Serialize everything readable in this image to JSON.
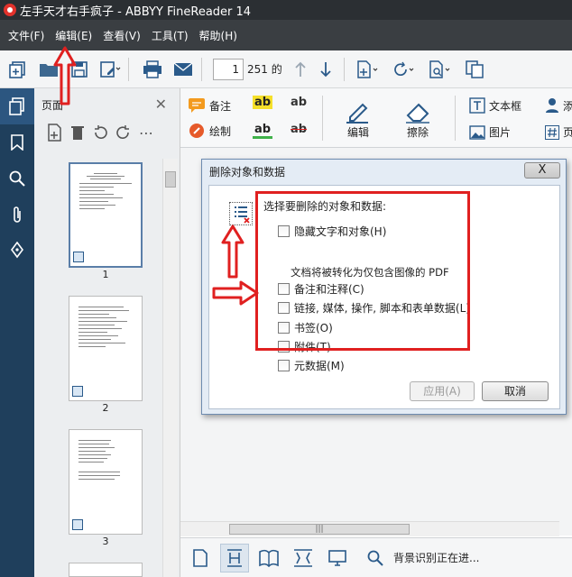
{
  "window": {
    "title": "左手天才右手疯子 - ABBYY FineReader 14"
  },
  "menu": [
    "文件(F)",
    "编辑(E)",
    "查看(V)",
    "工具(T)",
    "帮助(H)"
  ],
  "toolbar": {
    "current_page": "1",
    "page_total": "251 的"
  },
  "pages_panel": {
    "title": "页面",
    "thumbnails": [
      {
        "number": "1"
      },
      {
        "number": "2"
      },
      {
        "number": "3"
      }
    ]
  },
  "ribbon": {
    "note": "备注",
    "draw": "绘制",
    "edit": "编辑",
    "erase": "擦除",
    "textbox": "文本框",
    "add": "添",
    "image": "图片",
    "page_partial": "页",
    "ab": "ab"
  },
  "dialog": {
    "title": "删除对象和数据",
    "close": "X",
    "heading": "选择要删除的对象和数据:",
    "options": [
      {
        "label": "隐藏文字和对象(H)",
        "checked": false
      },
      {
        "label": "备注和注释(C)",
        "checked": false
      },
      {
        "label": "链接, 媒体, 操作, 脚本和表单数据(L)",
        "checked": false
      },
      {
        "label": "书签(O)",
        "checked": false
      },
      {
        "label": "附件(T)",
        "checked": false
      },
      {
        "label": "元数据(M)",
        "checked": false
      }
    ],
    "note": "文档将被转化为仅包含图像的 PDF",
    "apply": "应用(A)",
    "cancel": "取消"
  },
  "statusbar": {
    "text": "背景识别正在进..."
  },
  "colors": {
    "accent_red": "#e02020",
    "nav_blue": "#1f3f5c",
    "titlebar": "#2b2f33"
  }
}
